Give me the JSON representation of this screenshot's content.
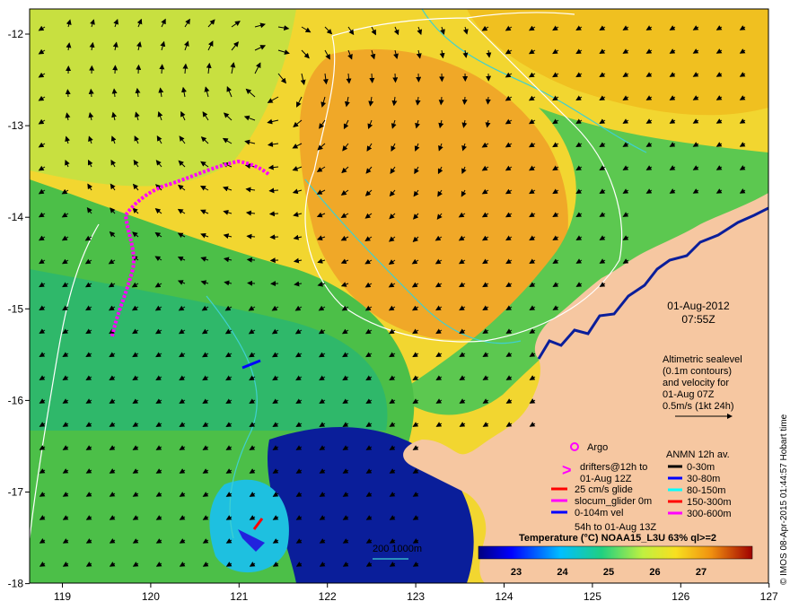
{
  "map": {
    "lon_labels": [
      "119",
      "120",
      "121",
      "122",
      "123",
      "124",
      "125",
      "126",
      "127"
    ],
    "lat_labels": [
      "-12",
      "-13",
      "-14",
      "-15",
      "-16",
      "-17",
      "-18"
    ],
    "date": "01-Aug-2012",
    "time": "07:55Z",
    "altimetry_note": [
      "Altimetric sealevel",
      "(0.1m contours)",
      "and velocity for",
      "01-Aug 07Z",
      "0.5m/s (1kt 24h)"
    ],
    "argo_label": "Argo",
    "drifters_label": [
      "drifters@12h to",
      "01-Aug 12Z"
    ],
    "glider_legend": [
      {
        "label": "25 cm/s glide",
        "color": "#ff0000"
      },
      {
        "label": "slocum_glider 0m",
        "color": "#ff00ff"
      },
      {
        "label": "0-104m vel",
        "color": "#0000ff"
      }
    ],
    "glider_period": "54h to 01-Aug 13Z",
    "anmn_title": "ANMN 12h av.",
    "anmn_legend": [
      {
        "label": "0-30m",
        "color": "#000000"
      },
      {
        "label": "30-80m",
        "color": "#0000ff"
      },
      {
        "label": "80-150m",
        "color": "#00ffff"
      },
      {
        "label": "150-300m",
        "color": "#ff0000"
      },
      {
        "label": "300-600m",
        "color": "#ff00ff"
      }
    ],
    "isobath_label": "200  1000m",
    "colorbar_title": "Temperature (°C) NOAA15_L3U 63% ql>=2",
    "colorbar_ticks": [
      "23",
      "24",
      "25",
      "26",
      "27"
    ],
    "credit": "© IMOS 08-Apr-2015 01:44:57 Hobart time",
    "colors": {
      "land": "#f6c7a1",
      "isobath_200": "#3fd0d0",
      "isobath_1000": "#ffffff"
    }
  }
}
